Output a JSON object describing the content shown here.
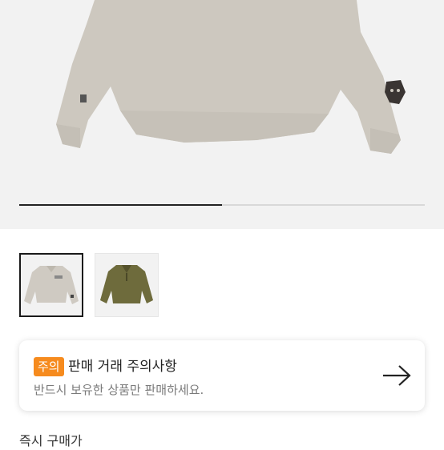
{
  "gallery": {
    "progress_fraction": 0.5,
    "thumbnails": [
      {
        "alt": "Oatmeal half-zip sweatshirt",
        "color": "#cfcac2",
        "selected": true
      },
      {
        "alt": "Olive half-zip sweatshirt",
        "color": "#6e6b3c",
        "selected": false
      }
    ]
  },
  "notice": {
    "badge": "주의",
    "title": "판매 거래 주의사항",
    "description": "반드시 보유한 상품만 판매하세요.",
    "arrow_icon": "arrow-right-icon"
  },
  "bottom": {
    "label": "즉시 구매가"
  }
}
